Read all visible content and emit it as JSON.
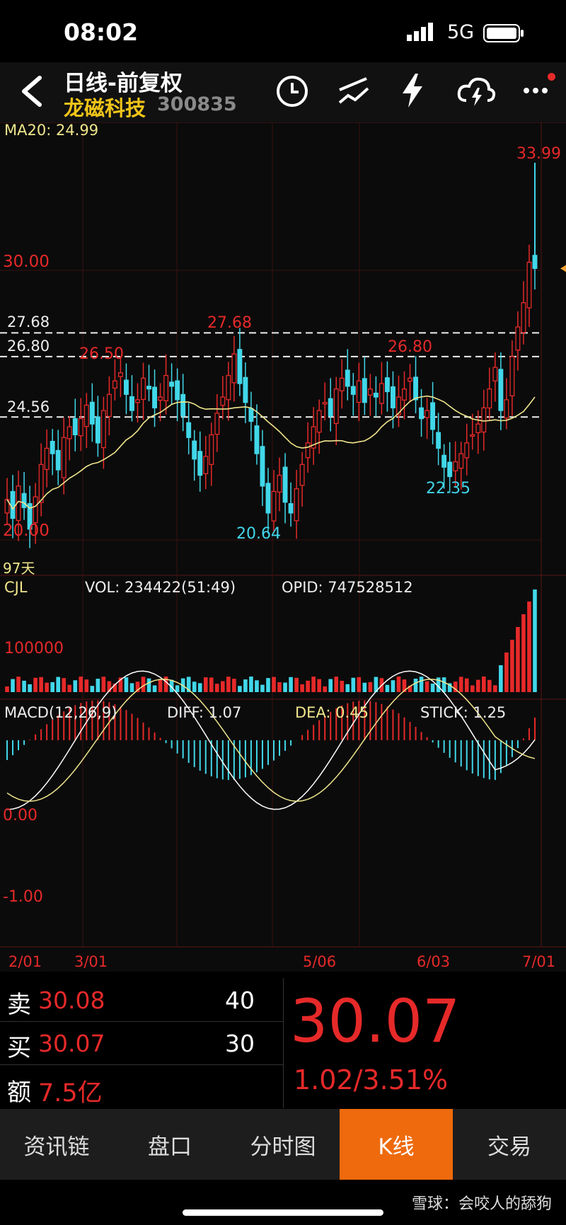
{
  "status": {
    "time": "08:02",
    "network": "5G"
  },
  "header": {
    "title": "日线-前复权",
    "stock_name": "龙磁科技",
    "stock_code": "300835"
  },
  "price_panel": {
    "ma_label": "MA20: 24.99",
    "price_levels": [
      "30.00",
      "20.00"
    ],
    "dashed_levels": [
      "27.68",
      "26.80",
      "24.56"
    ],
    "marks": {
      "high": "33.99",
      "peak1": "27.68",
      "peak2": "26.80",
      "peak3": "26.50",
      "low1": "20.64",
      "low2": "22.35"
    },
    "days_label": "97天"
  },
  "volume_panel": {
    "name": "CJL",
    "vol": "VOL: 234422(51:49)",
    "opid": "OPID: 747528512",
    "level": "100000"
  },
  "macd_panel": {
    "name": "MACD(12,26,9)",
    "diff": "DIFF: 1.07",
    "dea": "DEA: 0.45",
    "stick": "STICK: 1.25",
    "zero": "0.00",
    "neg": "-1.00"
  },
  "dates": [
    "2/01",
    "3/01",
    "5/06",
    "6/03",
    "7/01"
  ],
  "quote": {
    "sell_label": "卖",
    "sell_price": "30.08",
    "sell_qty": "40",
    "buy_label": "买",
    "buy_price": "30.07",
    "buy_qty": "30",
    "amount_label": "额",
    "amount": "7.5亿",
    "last_price": "30.07",
    "change": "1.02/3.51%"
  },
  "tabs": [
    "资讯链",
    "盘口",
    "分时图",
    "K线",
    "交易"
  ],
  "active_tab": 3,
  "watermark": "雪球：会咬人的舔狗",
  "chart_data": {
    "type": "candlestick",
    "ylim": [
      19.0,
      34.5
    ],
    "closes": [
      21.5,
      20.8,
      22.0,
      21.2,
      20.4,
      21.6,
      22.8,
      23.4,
      23.2,
      22.6,
      23.8,
      24.2,
      23.9,
      24.5,
      25.0,
      24.3,
      23.6,
      24.8,
      25.4,
      25.9,
      26.2,
      25.4,
      24.8,
      25.2,
      26.0,
      25.6,
      24.9,
      25.3,
      26.1,
      25.7,
      25.2,
      24.6,
      23.8,
      23.0,
      22.4,
      23.1,
      23.9,
      24.7,
      25.3,
      26.1,
      26.9,
      25.8,
      25.1,
      24.4,
      23.2,
      22.0,
      21.0,
      21.8,
      22.4,
      21.4,
      21.0,
      21.9,
      22.8,
      23.6,
      24.2,
      24.8,
      25.1,
      24.6,
      25.6,
      26.0,
      25.7,
      25.4,
      25.9,
      25.1,
      25.6,
      25.3,
      25.8,
      25.5,
      24.9,
      25.3,
      25.6,
      26.0,
      25.2,
      24.5,
      24.8,
      24.1,
      23.4,
      22.7,
      22.35,
      22.9,
      23.2,
      23.6,
      23.9,
      24.3,
      24.9,
      25.6,
      26.4,
      24.8,
      25.2,
      26.8,
      27.9,
      28.8,
      30.3,
      30.07
    ],
    "highs_note": "period high 33.99, lows 20.64 and 22.35",
    "volume": {
      "level_label": "100000"
    },
    "macd": {
      "diff": 1.07,
      "dea": 0.45,
      "stick": 1.25,
      "ylim": [
        -1.4,
        0.9
      ]
    }
  },
  "colors": {
    "up": "#e62929",
    "down": "#41d7e9",
    "ma": "#f0e68c",
    "accent": "#ee6a0c",
    "name": "#f0c419"
  }
}
